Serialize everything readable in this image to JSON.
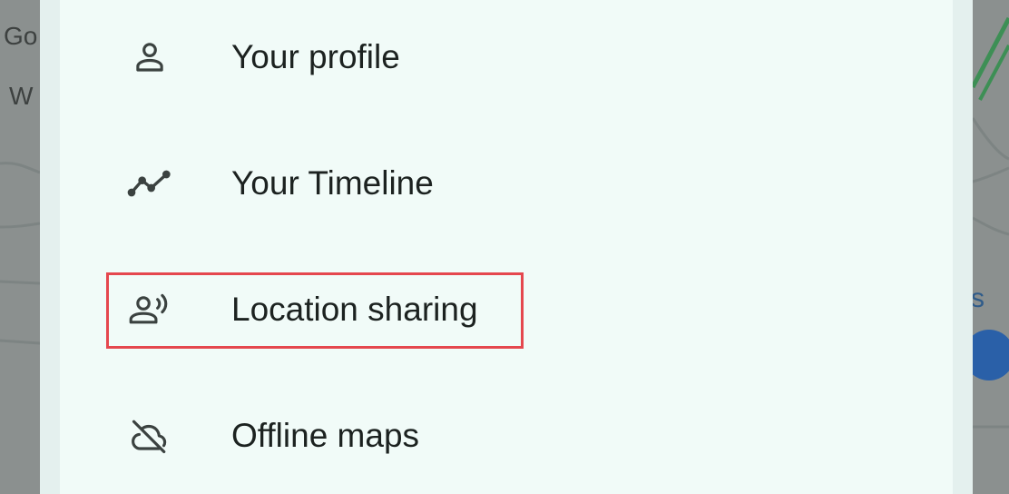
{
  "background_map": {
    "left_label_top": "Go",
    "left_label_second": "W",
    "right_label": "s"
  },
  "menu": {
    "items": [
      {
        "label": "Your profile",
        "icon": "person-icon"
      },
      {
        "label": "Your Timeline",
        "icon": "timeline-icon"
      },
      {
        "label": "Location sharing",
        "icon": "location-sharing-icon"
      },
      {
        "label": "Offline maps",
        "icon": "offline-cloud-icon"
      }
    ]
  },
  "colors": {
    "sheet_background": "#f1fbf8",
    "text": "#1c2220",
    "highlight_border": "#e5474e"
  }
}
